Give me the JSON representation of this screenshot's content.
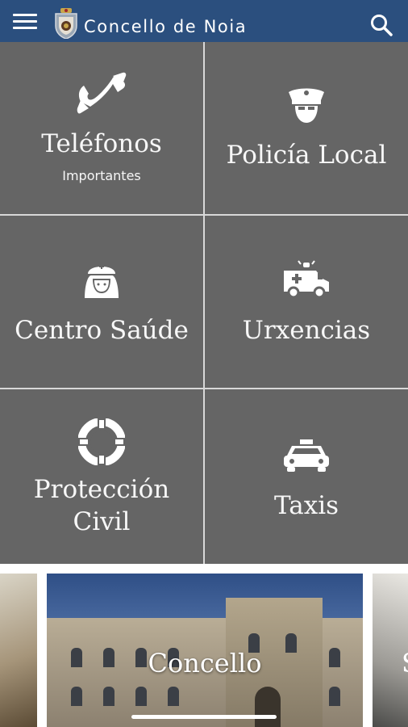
{
  "app_bar": {
    "title": "Concello de Noia",
    "menu_icon": "hamburger-menu-icon",
    "logo_icon": "coat-of-arms-logo",
    "search_icon": "search-icon",
    "background": "#2b4f7e"
  },
  "grid": {
    "tile_color": "#656565",
    "divider_color": "#d8d8d8",
    "tiles": [
      {
        "label": "Teléfonos",
        "sublabel": "Importantes",
        "icon": "phone-icon"
      },
      {
        "label": "Policía Local",
        "icon": "police-officer-icon"
      },
      {
        "label": "Centro Saúde",
        "icon": "nurse-icon"
      },
      {
        "label": "Urxencias",
        "icon": "ambulance-icon"
      },
      {
        "label": "Protección",
        "label2": "Civil",
        "icon": "lifebuoy-icon"
      },
      {
        "label": "Taxis",
        "icon": "taxi-icon"
      }
    ]
  },
  "carousel": {
    "cards": [
      {
        "title": ""
      },
      {
        "title": "Concello"
      },
      {
        "title": "S"
      }
    ]
  }
}
